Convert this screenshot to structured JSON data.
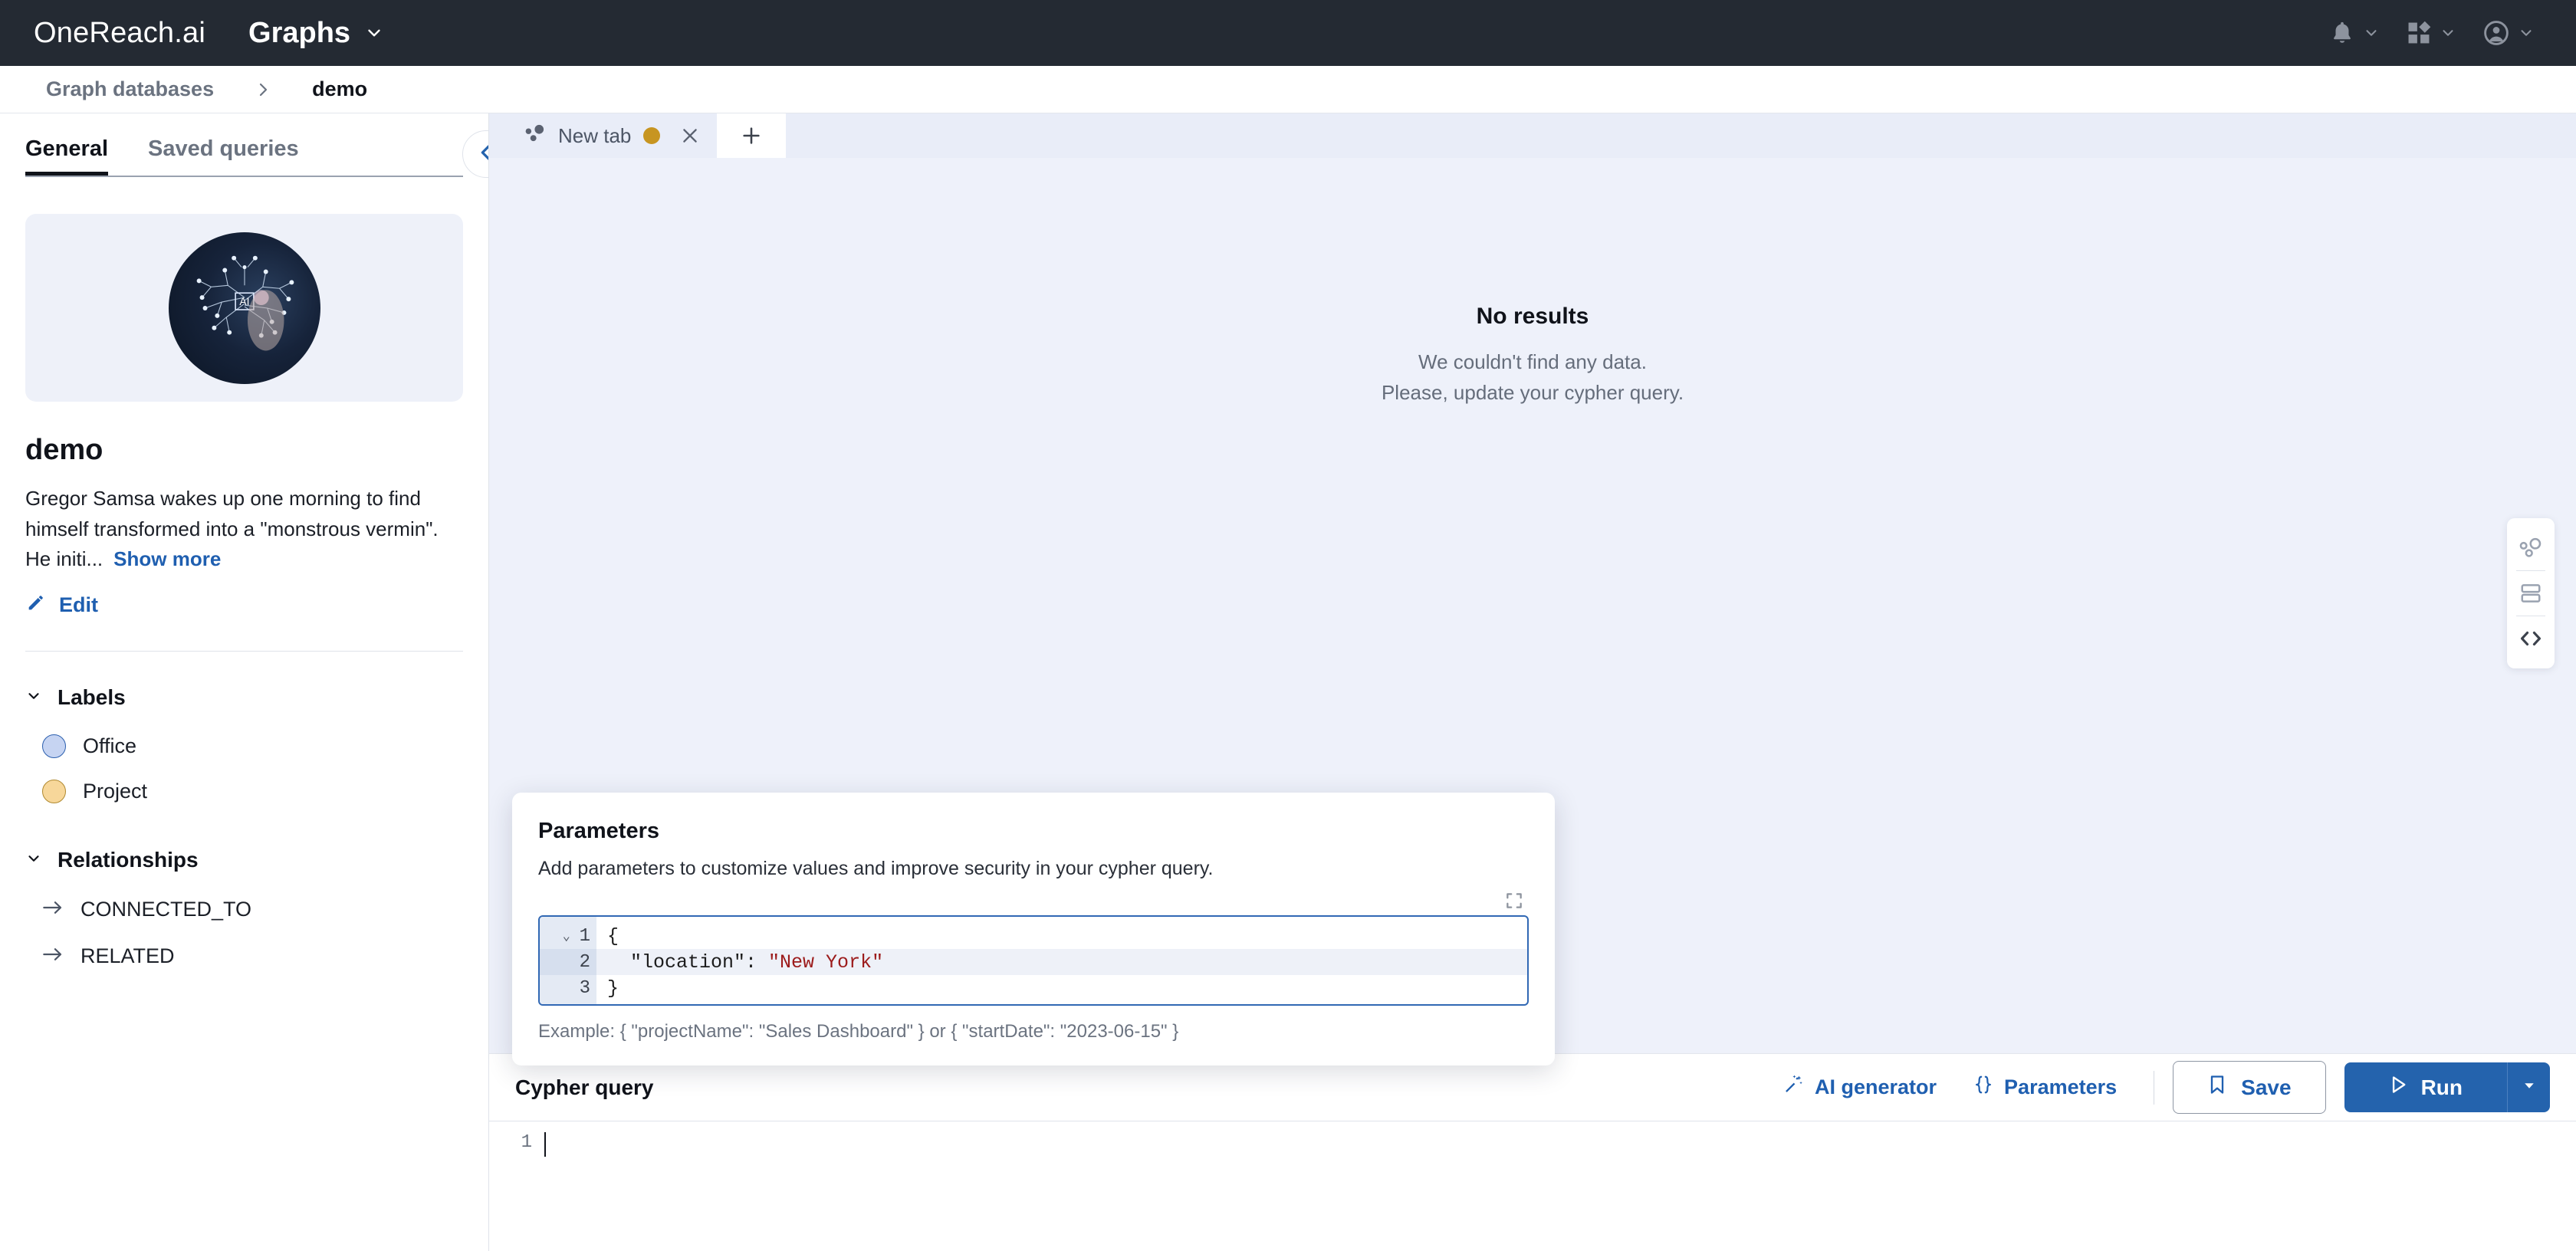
{
  "topnav": {
    "logo_text": "OneReach.ai",
    "app_name": "Graphs",
    "icons": [
      {
        "name": "bell-icon",
        "label": "Notifications"
      },
      {
        "name": "apps-grid-icon",
        "label": "Apps"
      },
      {
        "name": "account-circle-icon",
        "label": "Account"
      }
    ]
  },
  "breadcrumb": {
    "root": "Graph databases",
    "current": "demo"
  },
  "sidebar": {
    "tabs": [
      {
        "label": "General",
        "active": true
      },
      {
        "label": "Saved queries",
        "active": false
      }
    ],
    "thumbnail_name": "ai-brain-circuit-thumbnail",
    "db_title": "demo",
    "description": "Gregor Samsa wakes up one morning to find himself transformed into a \"monstrous vermin\". He initi...",
    "show_more": "Show more",
    "edit_label": "Edit",
    "labels_section": {
      "title": "Labels",
      "items": [
        {
          "label": "Office",
          "color": "#c6d4f2"
        },
        {
          "label": "Project",
          "color": "#f7d79a"
        }
      ]
    },
    "relationships_section": {
      "title": "Relationships",
      "items": [
        {
          "label": "CONNECTED_TO"
        },
        {
          "label": "RELATED"
        }
      ]
    }
  },
  "tabbar": {
    "tab_label": "New tab",
    "unsaved_dot_color": "#c79521",
    "add_tab_label": "+"
  },
  "results": {
    "title": "No results",
    "line1": "We couldn't find any data.",
    "line2": "Please, update your cypher query."
  },
  "view_rail": [
    {
      "name": "graph-view-icon",
      "active": false
    },
    {
      "name": "table-view-icon",
      "active": false
    },
    {
      "name": "code-view-icon",
      "active": true
    }
  ],
  "parameters_popover": {
    "title": "Parameters",
    "subtitle": "Add parameters to customize values and improve security in your cypher query.",
    "expand_icon": "expand-icon",
    "editor": {
      "lines": [
        {
          "number": "1",
          "fold": "⌄",
          "text": "{",
          "highlight": false
        },
        {
          "number": "2",
          "fold": "",
          "text": "\"location\": ",
          "string": "\"New York\"",
          "highlight": true
        },
        {
          "number": "3",
          "fold": "",
          "text": "}",
          "highlight": false
        }
      ]
    },
    "example": "Example: { \"projectName\": \"Sales Dashboard\" } or { \"startDate\": \"2023-06-15\" }"
  },
  "cypher_bar": {
    "label": "Cypher query",
    "ai_generator": "AI generator",
    "parameters": "Parameters",
    "save": "Save",
    "run": "Run"
  },
  "cypher_editor": {
    "line_number": "1",
    "value": ""
  },
  "colors": {
    "accent": "#2463ad",
    "link": "#1f5fb0",
    "topnav_bg": "#242a33",
    "canvas_bg": "#eef1fa"
  }
}
